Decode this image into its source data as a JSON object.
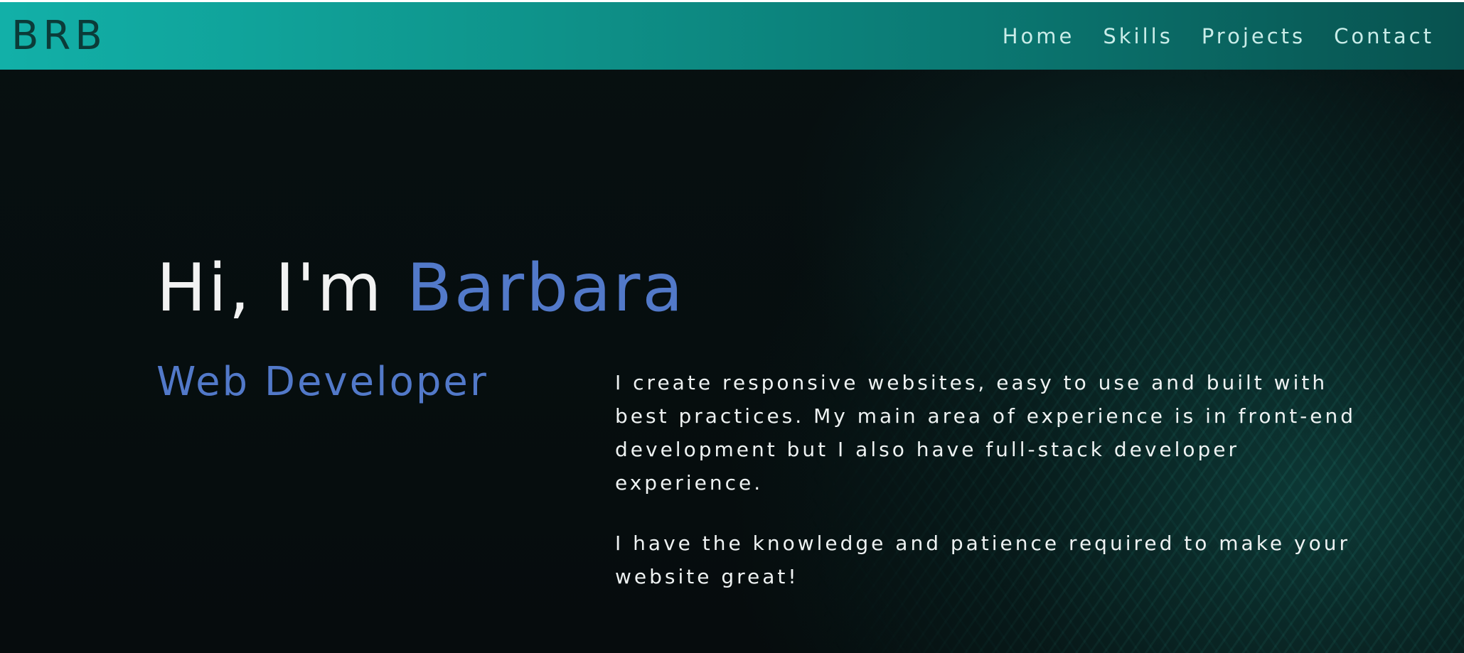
{
  "header": {
    "logo": "BRB",
    "nav": [
      {
        "label": "Home"
      },
      {
        "label": "Skills"
      },
      {
        "label": "Projects"
      },
      {
        "label": "Contact"
      }
    ]
  },
  "hero": {
    "greeting": "Hi, I'm ",
    "name": "Barbara",
    "role": "Web Developer",
    "paragraphs": [
      "I create responsive websites, easy to use and built with best practices. My main area of experience is in front-end development but I also have full-stack developer experience.",
      "I have the knowledge and patience required to make your website great!"
    ]
  },
  "colors": {
    "accent": "#5279c9",
    "navbar_start": "#12b0a8",
    "navbar_end": "#08524f",
    "background": "#060c0d"
  }
}
